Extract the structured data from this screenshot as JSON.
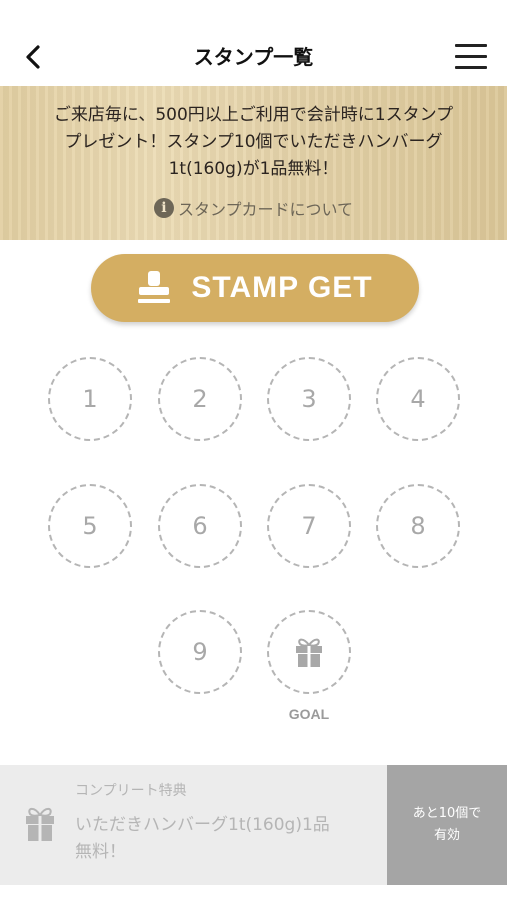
{
  "header": {
    "title": "スタンプ一覧"
  },
  "banner": {
    "text_line1": "ご来店毎に、500円以上ご利用で会計時に1スタンプ",
    "text_line2": "プレゼント！スタンプ10個でいただきハンバーグ",
    "text_line3": "1t(160g)が1品無料！",
    "about_link": "スタンプカードについて"
  },
  "stamp_button": {
    "label": "STAMP GET"
  },
  "stamps": {
    "slots": [
      "1",
      "2",
      "3",
      "4",
      "5",
      "6",
      "7",
      "8",
      "9"
    ],
    "goal_label": "GOAL",
    "collected": 0
  },
  "reward": {
    "caption": "コンプリート特典",
    "line1": "いただきハンバーグ1t(160g)1品",
    "line2": "無料！",
    "status_line1": "あと10個で",
    "status_line2": "有効"
  },
  "colors": {
    "accent_gold": "#d4ae62",
    "banner_wood": "#e6d5ab",
    "dashed_circle": "#b5b5b5",
    "footer_status_bg": "#a5a5a5"
  },
  "icons": {
    "back": "chevron-left-icon",
    "menu": "hamburger-menu-icon",
    "info": "info-icon",
    "stamp": "stamp-icon",
    "gift": "gift-icon"
  }
}
